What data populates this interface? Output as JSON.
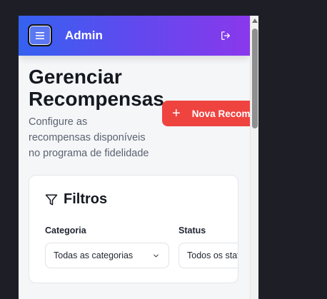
{
  "header": {
    "title": "Admin",
    "menu_icon": "menu-icon",
    "logout_icon": "logout-icon",
    "gradient_start": "#3562f0",
    "gradient_end": "#8a38ec"
  },
  "page": {
    "title": "Gerenciar Recompensas",
    "subtitle": "Configure as recompensas disponíveis no programa de fidelidade"
  },
  "new_button": {
    "label": "Nova Recompensa",
    "icon": "plus-icon",
    "color": "#ef4340"
  },
  "filters": {
    "title": "Filtros",
    "icon": "filter-icon",
    "category": {
      "label": "Categoria",
      "selected": "Todas as categorias"
    },
    "status": {
      "label": "Status",
      "selected": "Todos os status"
    }
  }
}
